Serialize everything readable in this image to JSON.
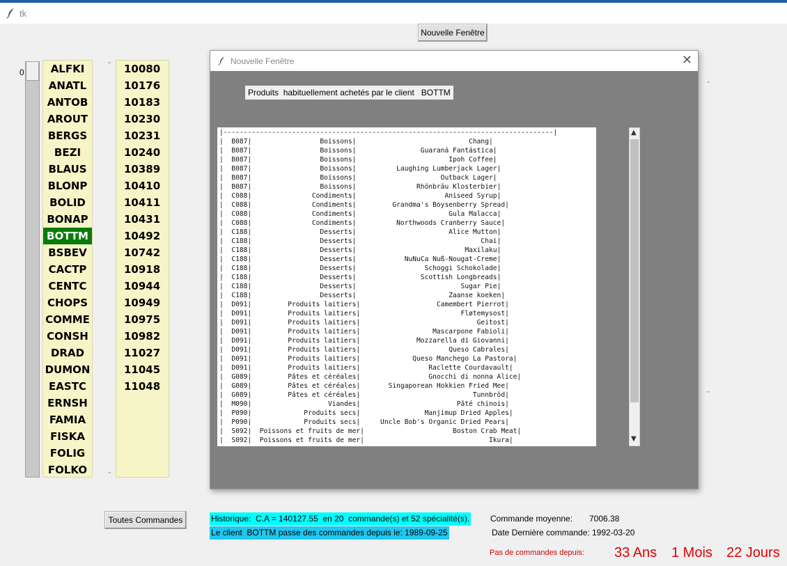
{
  "window": {
    "title": "tk"
  },
  "new_window_button": "Nouvelle Fenêtre",
  "scale": {
    "value": "0"
  },
  "clients": [
    "ALFKI",
    "ANATL",
    "ANTOB",
    "AROUT",
    "BERGS",
    "BEZI",
    "BLAUS",
    "BLONP",
    "BOLID",
    "BONAP",
    "BOTTM",
    "BSBEV",
    "CACTP",
    "CENTC",
    "CHOPS",
    "COMME",
    "CONSH",
    "DRAD",
    "DUMON",
    "EASTC",
    "ERNSH",
    "FAMIA",
    "FISKA",
    "FOLIG",
    "FOLKO"
  ],
  "selected_client_index": 10,
  "orders": [
    "10080",
    "10176",
    "10183",
    "10230",
    "10231",
    "10240",
    "10389",
    "10410",
    "10411",
    "10431",
    "10492",
    "10742",
    "10918",
    "10944",
    "10949",
    "10975",
    "10982",
    "11027",
    "11045",
    "11048"
  ],
  "modal": {
    "title": "Nouvelle Fenêtre",
    "close": "✕",
    "label": "Produits  habituellement achetés par le client   BOTTM",
    "lines": [
      "|----------------------------------------------------------------------------------|",
      "|  B087|                 Boissons|                            Chang|",
      "|  B087|                 Boissons|                Guaraná Fantástica|",
      "|  B087|                 Boissons|                       Ipoh Coffee|",
      "|  B087|                 Boissons|          Laughing Lumberjack Lager|",
      "|  B087|                 Boissons|                     Outback Lager|",
      "|  B087|                 Boissons|               Rhönbräu Klosterbier|",
      "|  C088|               Condiments|                      Aniseed Syrup|",
      "|  C088|               Condiments|         Grandma's Boysenberry Spread|",
      "|  C088|               Condiments|                       Gula Malacca|",
      "|  C088|               Condiments|          Northwoods Cranberry Sauce|",
      "|  C188|                 Desserts|                       Alice Mutton|",
      "|  C188|                 Desserts|                               Chai|",
      "|  C188|                 Desserts|                           Maxilaku|",
      "|  C188|                 Desserts|            NuNuCa Nuß-Nougat-Creme|",
      "|  C188|                 Desserts|                 Schoggi Schokolade|",
      "|  C188|                 Desserts|                Scottish Longbreads|",
      "|  C188|                 Desserts|                          Sugar Pie|",
      "|  C188|                 Desserts|                       Zaanse koeken|",
      "|  D091|         Produits laitiers|                   Camembert Pierrot|",
      "|  D091|         Produits laitiers|                         Fløtemysost|",
      "|  D091|         Produits laitiers|                             Geitost|",
      "|  D091|         Produits laitiers|                  Mascarpone Fabioli|",
      "|  D091|         Produits laitiers|              Mozzarella di Giovanni|",
      "|  D091|         Produits laitiers|                      Queso Cabrales|",
      "|  D091|         Produits laitiers|             Queso Manchego La Pastora|",
      "|  D091|         Produits laitiers|                 Raclette Courdavault|",
      "|  G089|         Pâtes et céréales|                 Gnocchi di nonna Alice|",
      "|  G089|         Pâtes et céréales|       Singaporean Hokkien Fried Mee|",
      "|  G089|         Pâtes et céréales|                            Tunnbröd|",
      "|  M090|                   Viandes|                        Pâté chinois|",
      "|  P090|             Produits secs|                Manjimup Dried Apples|",
      "|  P090|             Produits secs|     Uncle Bob's Organic Dried Pears|",
      "|  S092|  Poissons et fruits de mer|                      Boston Crab Meat|",
      "|  S092|  Poissons et fruits de mer|                               Ikura|"
    ]
  },
  "footer": {
    "toutes_commandes": "Toutes Commandes",
    "historique": "Historique:  C.A = 140127.55  en 20  commande(s) et 52 spécialité(s).",
    "client_depuis": "Le client  BOTTM passe des commandes depuis le: 1989-09-25",
    "commande_moyenne_label": "Commande moyenne:",
    "commande_moyenne_value": "7006.38",
    "derniere_label": "Date Dernière commande:",
    "derniere_value": "1992-03-20",
    "pas_depuis_label": "Pas de commandes depuis:",
    "ans": "33 Ans",
    "mois": "1 Mois",
    "jours": "22 Jours"
  },
  "icons": {
    "app": "feather-icon",
    "up": "▲",
    "down": "▼",
    "up_light": "⌃",
    "down_light": "⌄"
  }
}
